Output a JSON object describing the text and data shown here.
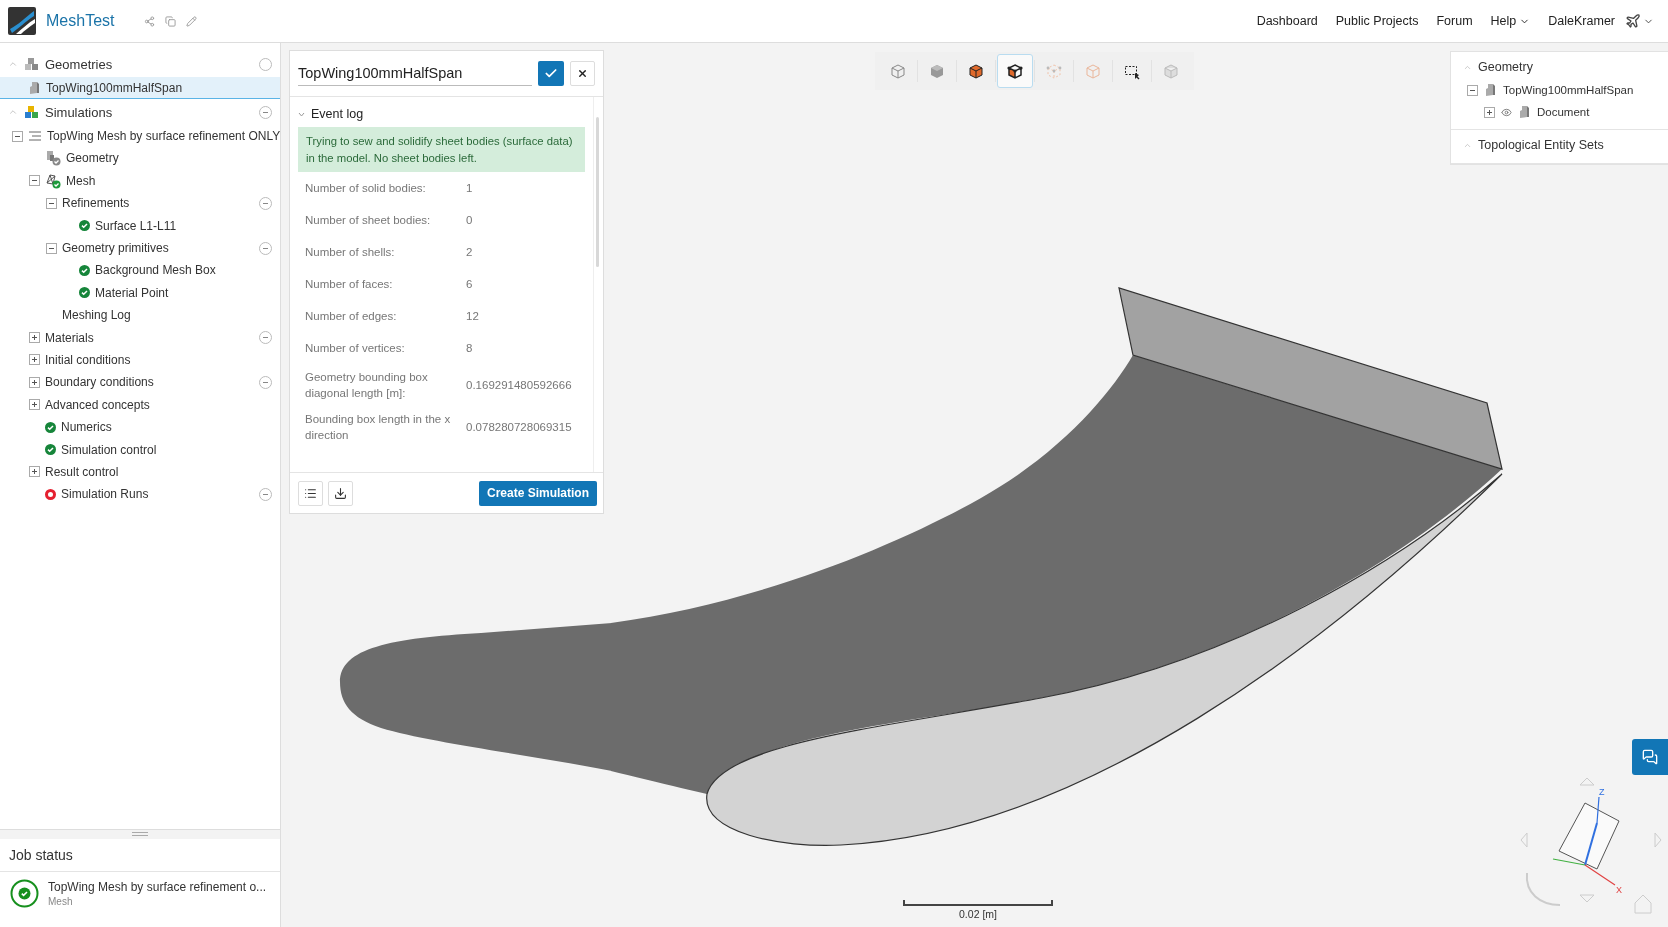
{
  "header": {
    "app_name": "MeshTest",
    "nav": [
      {
        "label": "Dashboard",
        "dropdown": false
      },
      {
        "label": "Public Projects",
        "dropdown": false
      },
      {
        "label": "Forum",
        "dropdown": false
      },
      {
        "label": "Help",
        "dropdown": true
      }
    ],
    "user": "DaleKramer"
  },
  "sections": [
    {
      "title": "Geometries",
      "kind": "geometries",
      "collapsible": false,
      "nodes": [
        {
          "label": "TopWing100mmHalfSpan",
          "kind": "geometry",
          "selected": true
        }
      ]
    },
    {
      "title": "Simulations",
      "kind": "simulations",
      "collapsible": true,
      "nodes": [
        {
          "label": "TopWing Mesh by surface refinement ONLY",
          "kind": "list",
          "expanded": true,
          "selected": false,
          "children": [
            {
              "label": "Geometry",
              "kind": "geometry-check",
              "selected": false
            },
            {
              "label": "Mesh",
              "kind": "mesh",
              "expanded": true,
              "selected": false,
              "children": [
                {
                  "label": "Refinements",
                  "expanded": true,
                  "collapsible": true,
                  "selected": false,
                  "children": [
                    {
                      "label": "Surface L1-L11",
                      "kind": "ok",
                      "selected": false
                    }
                  ]
                },
                {
                  "label": "Geometry primitives",
                  "expanded": true,
                  "collapsible": true,
                  "selected": false,
                  "children": [
                    {
                      "label": "Background Mesh Box",
                      "kind": "ok",
                      "selected": false
                    },
                    {
                      "label": "Material Point",
                      "kind": "ok",
                      "selected": false
                    }
                  ]
                },
                {
                  "label": "Meshing Log",
                  "selected": false
                }
              ]
            },
            {
              "label": "Materials",
              "expanded": false,
              "collapsible": true,
              "selected": false
            },
            {
              "label": "Initial conditions",
              "expanded": false,
              "selected": false
            },
            {
              "label": "Boundary conditions",
              "expanded": false,
              "collapsible": true,
              "selected": false
            },
            {
              "label": "Advanced concepts",
              "expanded": false,
              "selected": false
            },
            {
              "label": "Numerics",
              "kind": "ok",
              "selected": false
            },
            {
              "label": "Simulation control",
              "kind": "ok",
              "selected": false
            },
            {
              "label": "Result control",
              "expanded": false,
              "selected": false
            },
            {
              "label": "Simulation Runs",
              "kind": "error",
              "collapsible": true,
              "selected": false
            }
          ]
        }
      ]
    }
  ],
  "job_status": {
    "title": "Job status",
    "jobs": [
      {
        "title": "TopWing Mesh by surface refinement o...",
        "subtitle": "Mesh",
        "kind": "ok"
      }
    ]
  },
  "event_panel": {
    "name": "TopWing100mmHalfSpan",
    "section": {
      "title": "Event log",
      "expanded": true
    },
    "message": "Trying to sew and solidify sheet bodies (surface data) in the model. No sheet bodies left.",
    "rows": [
      {
        "label": "Number of solid bodies:",
        "value": "1"
      },
      {
        "label": "Number of sheet bodies:",
        "value": "0"
      },
      {
        "label": "Number of shells:",
        "value": "2"
      },
      {
        "label": "Number of faces:",
        "value": "6"
      },
      {
        "label": "Number of edges:",
        "value": "12"
      },
      {
        "label": "Number of vertices:",
        "value": "8"
      },
      {
        "label": "Geometry bounding box diagonal length [m]:",
        "value": "0.169291480592666"
      },
      {
        "label": "Bounding box length in the x direction",
        "value": "0.078280728069315"
      }
    ],
    "primary_button": "Create Simulation"
  },
  "toolbar": [
    {
      "kind": "wireframe",
      "selected": false
    },
    {
      "kind": "solid",
      "selected": false
    },
    {
      "kind": "solid-edges",
      "selected": false
    },
    {
      "kind": "solid-edges-points",
      "selected": true
    },
    {
      "kind": "points",
      "selected": false
    },
    {
      "kind": "faint",
      "selected": false
    },
    {
      "kind": "box-select",
      "selected": false
    },
    {
      "kind": "hidden",
      "selected": false
    }
  ],
  "scene_tree": {
    "sections": [
      {
        "title": "Geometry",
        "nodes": [
          {
            "label": "TopWing100mmHalfSpan",
            "expanded": true,
            "children": [
              {
                "label": "Document",
                "expanded": false,
                "visible": true
              }
            ]
          }
        ]
      },
      {
        "title": "Topological Entity Sets"
      }
    ]
  },
  "scale_bar": "0.02 [m]",
  "nav_cube": {
    "axes": [
      "Z",
      "X"
    ]
  }
}
